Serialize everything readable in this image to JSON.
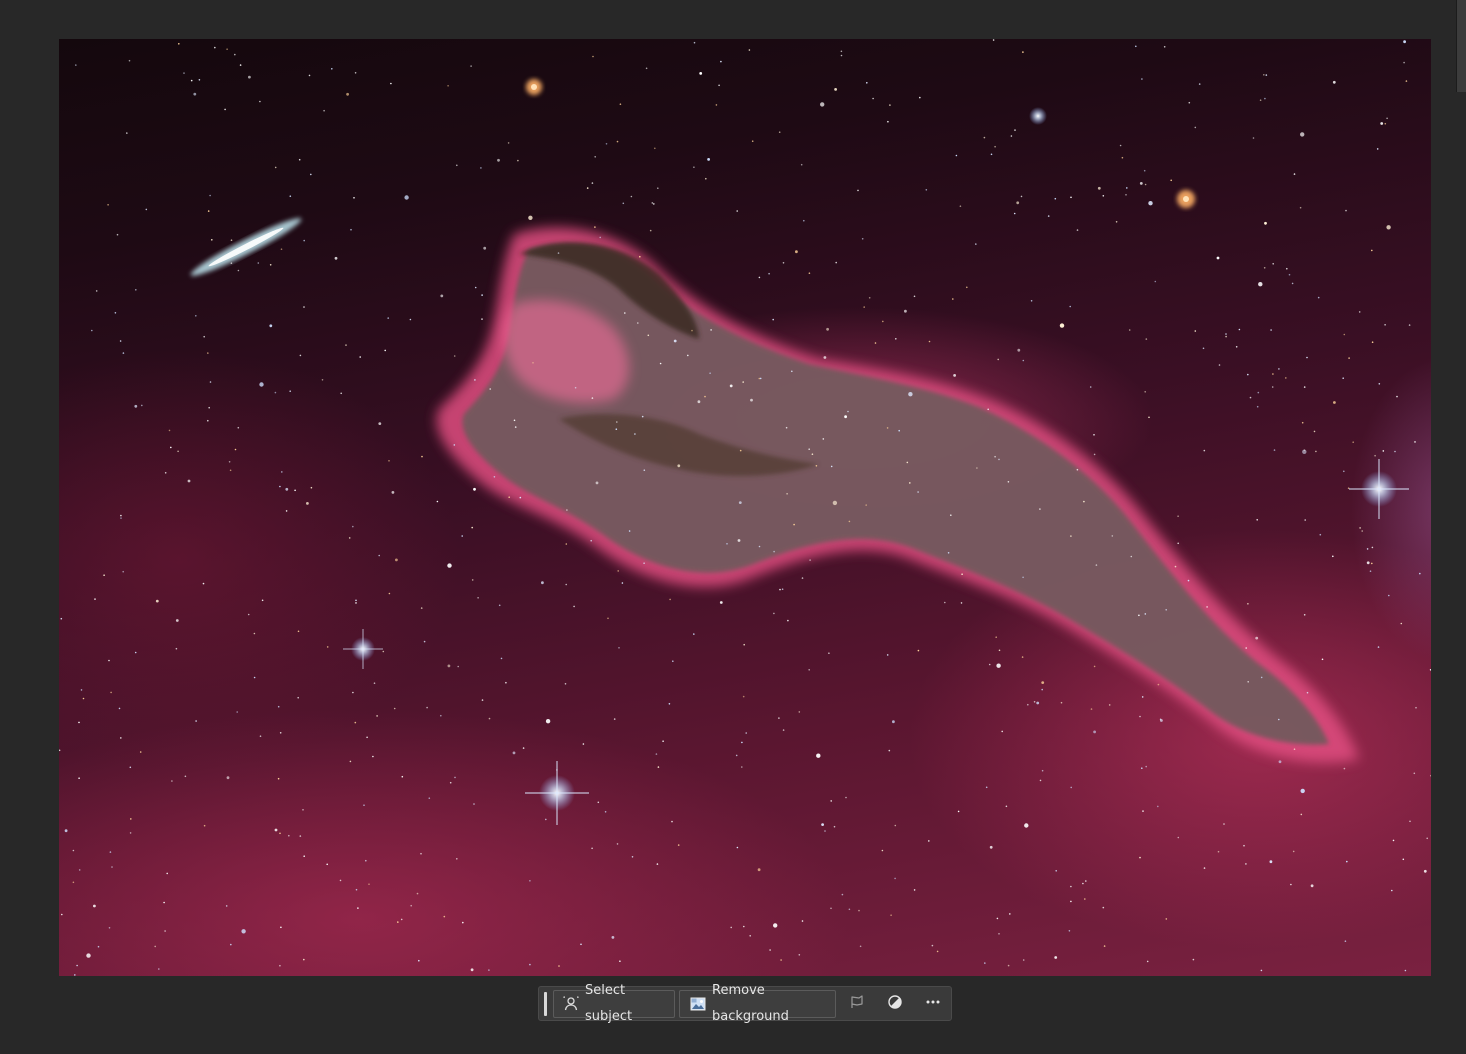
{
  "context_bar": {
    "select_subject_label": "Select subject",
    "select_subject_icon": "person-select-icon",
    "remove_background_label": "Remove background",
    "remove_background_icon": "image-icon",
    "generative_icon": "flag-icon",
    "adjustment_icon": "half-circle-icon",
    "more_icon": "more-dots-icon"
  },
  "colors": {
    "workspace_background": "#282828",
    "toolbar_background": "#3a3a3a",
    "toolbar_text": "#e6e6e6",
    "nebula_pink": "#d64a78",
    "nebula_dust": "#6e5a5c"
  }
}
